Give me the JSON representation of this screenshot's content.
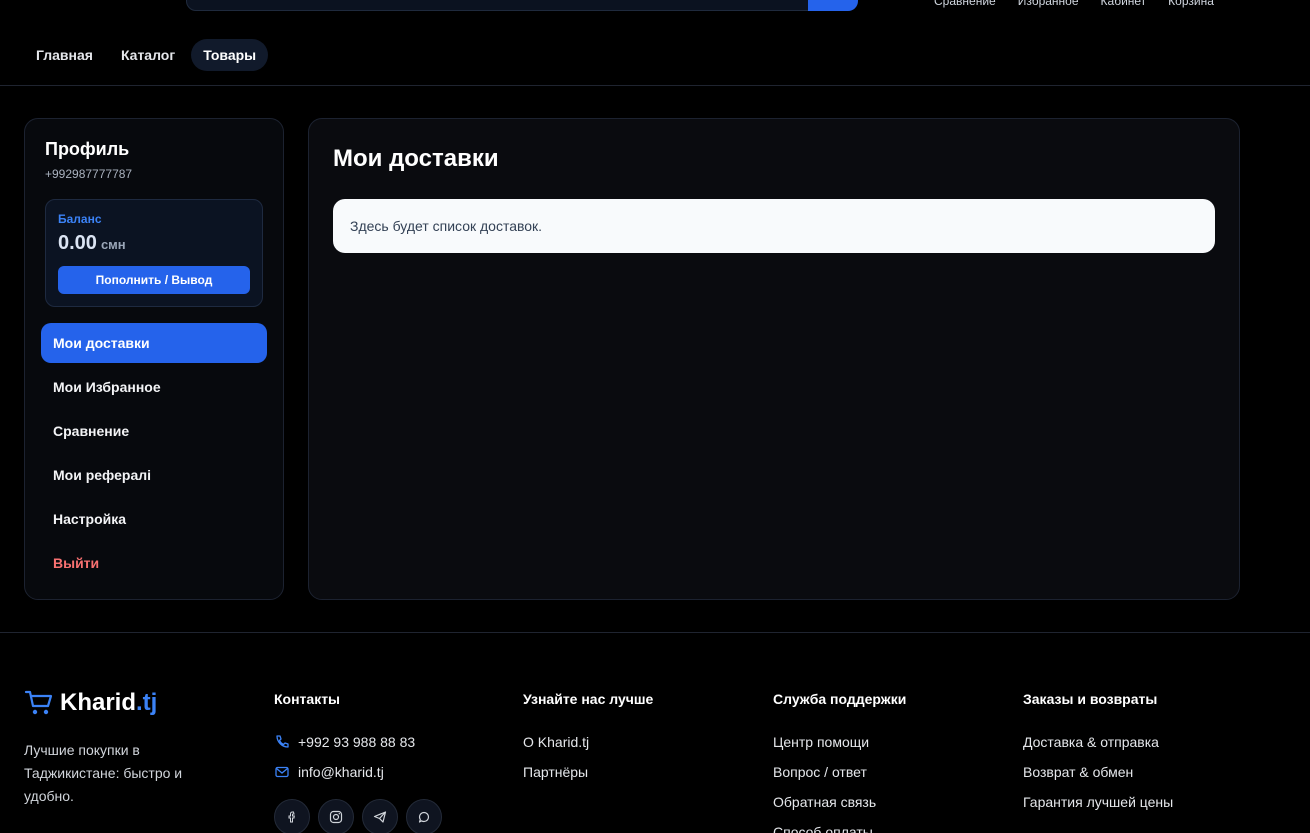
{
  "header": {
    "top_links": [
      "Сравнение",
      "Избранное",
      "Кабинет",
      "Корзина"
    ],
    "nav": [
      {
        "label": "Главная",
        "active": false
      },
      {
        "label": "Каталог",
        "active": false
      },
      {
        "label": "Товары",
        "active": true
      }
    ]
  },
  "sidebar": {
    "title": "Профиль",
    "phone": "+992987777787",
    "balance": {
      "label": "Баланс",
      "amount": "0.00",
      "currency": "смн",
      "button": "Пополнить / Вывод"
    },
    "menu": [
      {
        "label": "Мои доставки",
        "active": true
      },
      {
        "label": "Мои Избранное",
        "active": false
      },
      {
        "label": "Сравнение",
        "active": false
      },
      {
        "label": "Мои рефералi",
        "active": false
      },
      {
        "label": "Настройка",
        "active": false
      },
      {
        "label": "Выйти",
        "active": false
      }
    ]
  },
  "main": {
    "title": "Мои доставки",
    "empty_text": "Здесь будет список доставок."
  },
  "footer": {
    "brand": {
      "name": "Kharid",
      "tld": ".tj"
    },
    "description": "Лучшие покупки в Таджикистане: быстро и удобно.",
    "contacts": {
      "title": "Контакты",
      "phone": "+992 93 988 88 83",
      "email": "info@kharid.tj",
      "socials": [
        "facebook-icon",
        "instagram-icon",
        "telegram-icon",
        "whatsapp-icon"
      ]
    },
    "about": {
      "title": "Узнайте нас лучше",
      "links": [
        "О Kharid.tj",
        "Партнёры"
      ]
    },
    "support": {
      "title": "Служба поддержки",
      "links": [
        "Центр помощи",
        "Вопрос / ответ",
        "Обратная связь",
        "Способ оплаты"
      ]
    },
    "orders": {
      "title": "Заказы и возвраты",
      "links": [
        "Доставка & отправка",
        "Возврат & обмен",
        "Гарантия лучшей цены"
      ]
    }
  },
  "colors": {
    "accent": "#2563eb",
    "logout": "#f87171",
    "background": "#000000"
  }
}
